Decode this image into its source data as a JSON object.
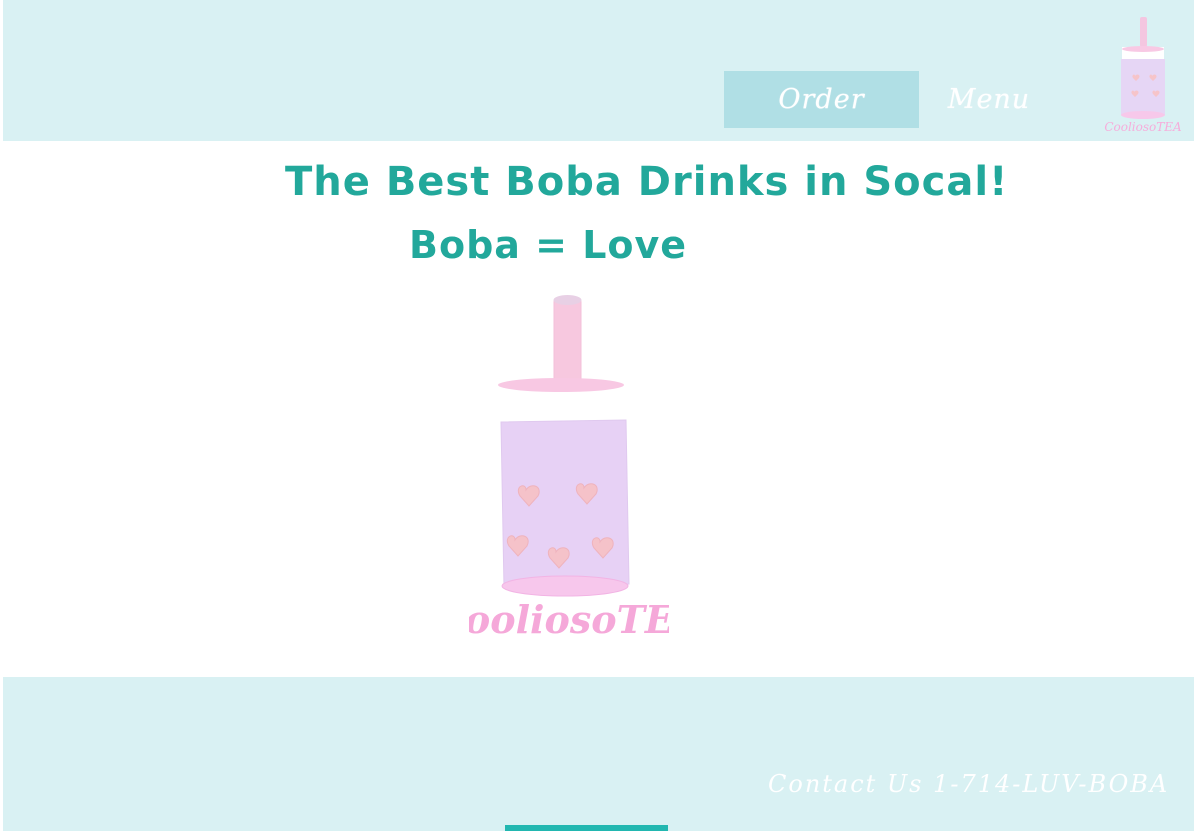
{
  "header": {
    "nav_items": [
      {
        "label": "Order"
      },
      {
        "label": "Menu"
      }
    ],
    "logo_text": "CooliosoTEA"
  },
  "hero": {
    "title": "The Best Boba Drinks in Socal!",
    "subtitle": "Boba = Love",
    "logo_text": "CooliosoTEA"
  },
  "footer": {
    "contact_text": "Contact Us 1-714-LUV-BOBA"
  },
  "colors": {
    "header_bg": "#d9f1f3",
    "button_bg": "#b0dfe5",
    "title_teal": "#22a89b",
    "cup_lavender": "#e5d2f3",
    "pink": "#f8c4df",
    "logo_pink": "#f5a8d9"
  }
}
